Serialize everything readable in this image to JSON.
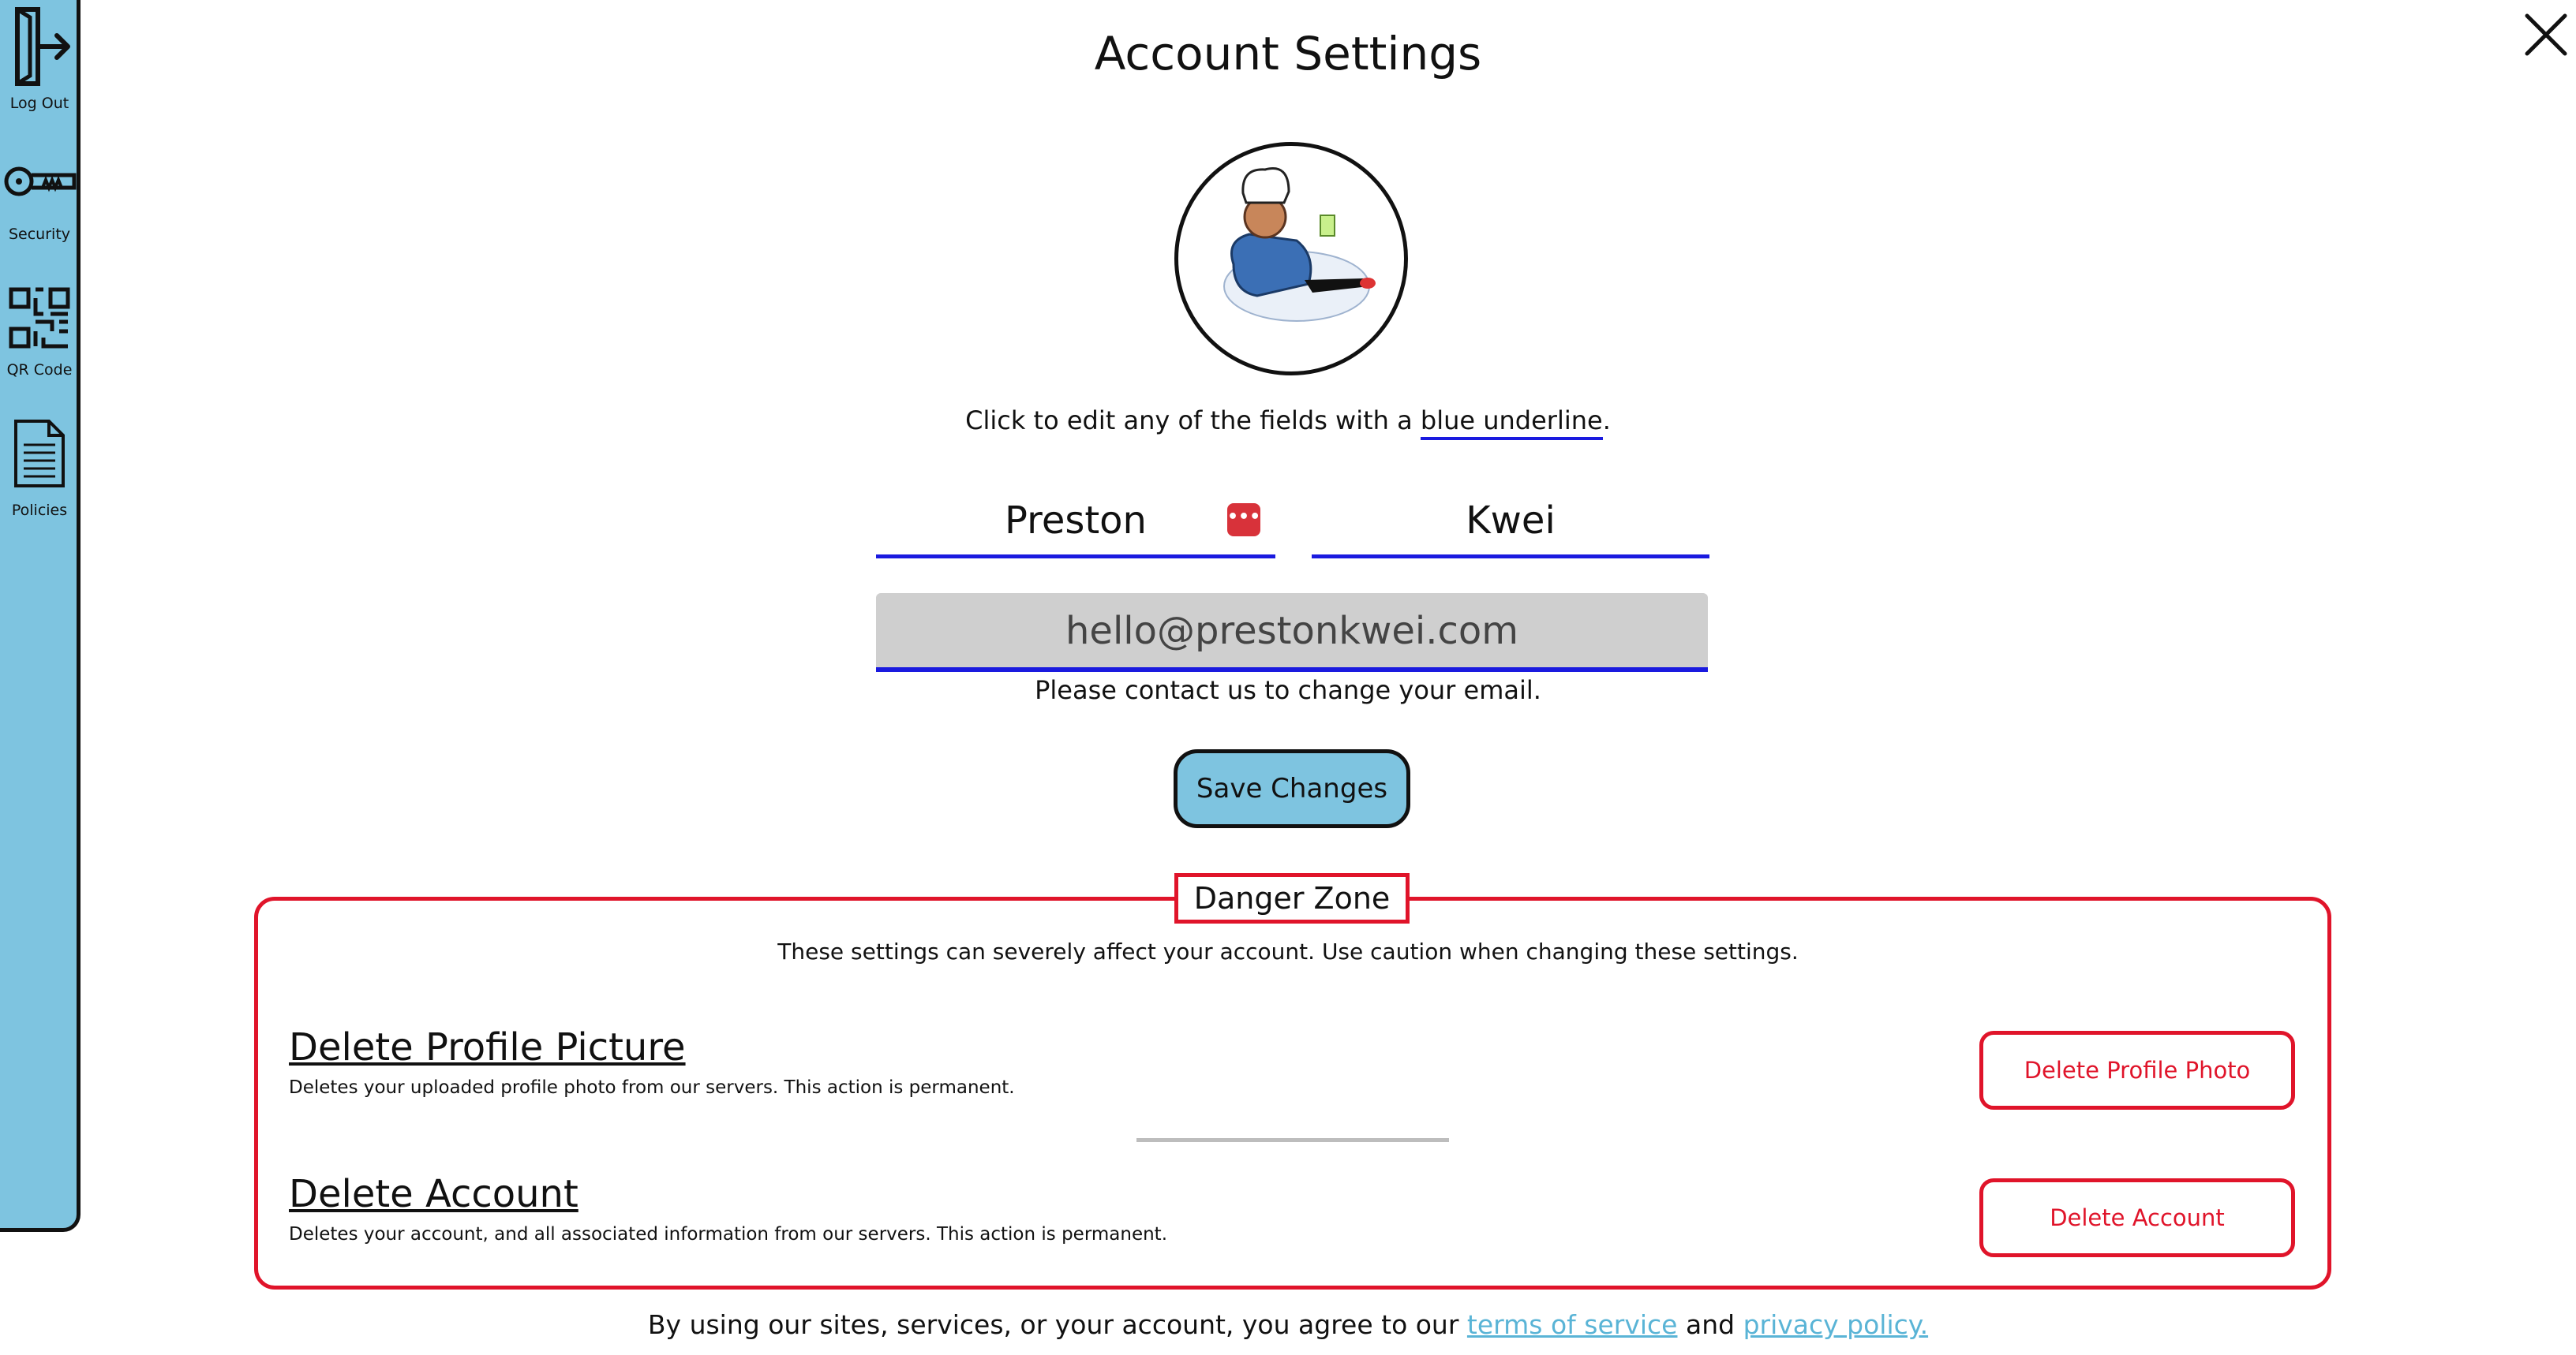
{
  "sidebar": {
    "items": [
      {
        "label": "Log Out",
        "icon": "logout-icon"
      },
      {
        "label": "Security",
        "icon": "key-icon"
      },
      {
        "label": "QR Code",
        "icon": "qr-code-icon"
      },
      {
        "label": "Policies",
        "icon": "document-icon"
      }
    ]
  },
  "page": {
    "title": "Account Settings",
    "hint_prefix": "Click to edit any of the fields with a ",
    "hint_link": "blue underline",
    "hint_suffix": "."
  },
  "profile": {
    "first_name": "Preston",
    "last_name": "Kwei",
    "password_manager_icon": "password-manager-icon",
    "email": "hello@prestonkwei.com",
    "email_note": "Please contact us to change your email."
  },
  "actions": {
    "save_label": "Save Changes"
  },
  "danger_zone": {
    "label": "Danger Zone",
    "description": "These settings can severely affect your account. Use caution when changing these settings.",
    "rows": [
      {
        "title": "Delete Profile Picture",
        "desc": "Deletes your uploaded profile photo from our servers. This action is permanent.",
        "button": "Delete Profile Photo"
      },
      {
        "title": "Delete Account",
        "desc": "Deletes your account, and all associated information from our servers. This action is permanent.",
        "button": "Delete Account"
      }
    ]
  },
  "footer": {
    "prefix": "By using our sites, services, or your account, you agree to our ",
    "tos": "terms of service",
    "middle": " and ",
    "privacy": "privacy policy."
  },
  "colors": {
    "sidebar_bg": "#7ec4e0",
    "field_underline": "#1a1adf",
    "danger": "#e0142a",
    "link": "#5ab4d6"
  }
}
